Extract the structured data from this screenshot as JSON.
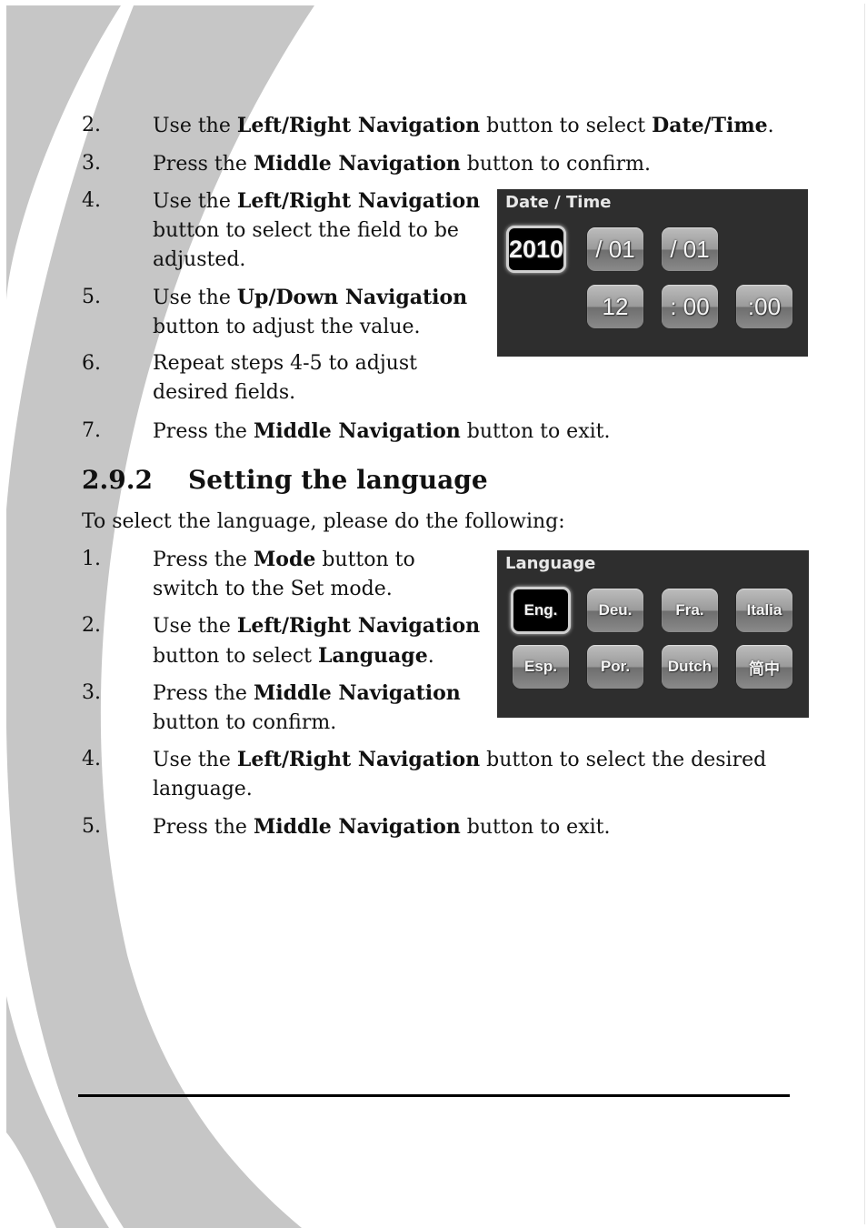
{
  "section_a_steps": [
    {
      "num": "2.",
      "lines": [
        [
          "Use the ",
          "Left/Right Navigation",
          " button to select ",
          "Date/Time",
          "."
        ]
      ]
    },
    {
      "num": "3.",
      "lines": [
        [
          "Press the ",
          "Middle Navigation",
          " button to confirm."
        ]
      ]
    },
    {
      "num": "4.",
      "lines": [
        [
          "Use the ",
          "Left/Right Navigation"
        ],
        [
          "button to select the field to be"
        ],
        [
          "adjusted."
        ]
      ]
    },
    {
      "num": "5.",
      "lines": [
        [
          "Use the ",
          "Up/Down Navigation"
        ],
        [
          "button to adjust the value."
        ]
      ]
    },
    {
      "num": "6.",
      "lines": [
        [
          "Repeat steps 4-5 to adjust"
        ],
        [
          "desired fields."
        ]
      ]
    },
    {
      "num": "7.",
      "lines": [
        [
          "Press the ",
          "Middle Navigation",
          " button to exit."
        ]
      ]
    }
  ],
  "heading": {
    "number": "2.9.2",
    "title": "Setting the language"
  },
  "intro": "To select the language, please do the following:",
  "section_b_steps": [
    {
      "num": "1.",
      "lines": [
        [
          "Press the ",
          "Mode",
          " button to"
        ],
        [
          "switch to the Set mode."
        ]
      ]
    },
    {
      "num": "2.",
      "lines": [
        [
          "Use the ",
          "Left/Right Navigation"
        ],
        [
          "button to select ",
          "Language",
          "."
        ]
      ]
    },
    {
      "num": "3.",
      "lines": [
        [
          "Press the ",
          "Middle Navigation"
        ],
        [
          "button to confirm."
        ]
      ]
    },
    {
      "num": "4.",
      "lines": [
        [
          "Use the ",
          "Left/Right Navigation",
          " button to select the desired"
        ],
        [
          "language."
        ]
      ]
    },
    {
      "num": "5.",
      "lines": [
        [
          "Press the ",
          "Middle Navigation",
          " button to exit."
        ]
      ]
    }
  ],
  "datetime_panel": {
    "title": "Date / Time",
    "selected": "2010",
    "fields": [
      "2010",
      "/ 01",
      "/ 01",
      "12",
      ": 00",
      ":00"
    ]
  },
  "language_panel": {
    "title": "Language",
    "selected": "Eng.",
    "options": [
      "Eng.",
      "Deu.",
      "Fra.",
      "Italia",
      "Esp.",
      "Por.",
      "Dutch",
      "简中"
    ]
  }
}
